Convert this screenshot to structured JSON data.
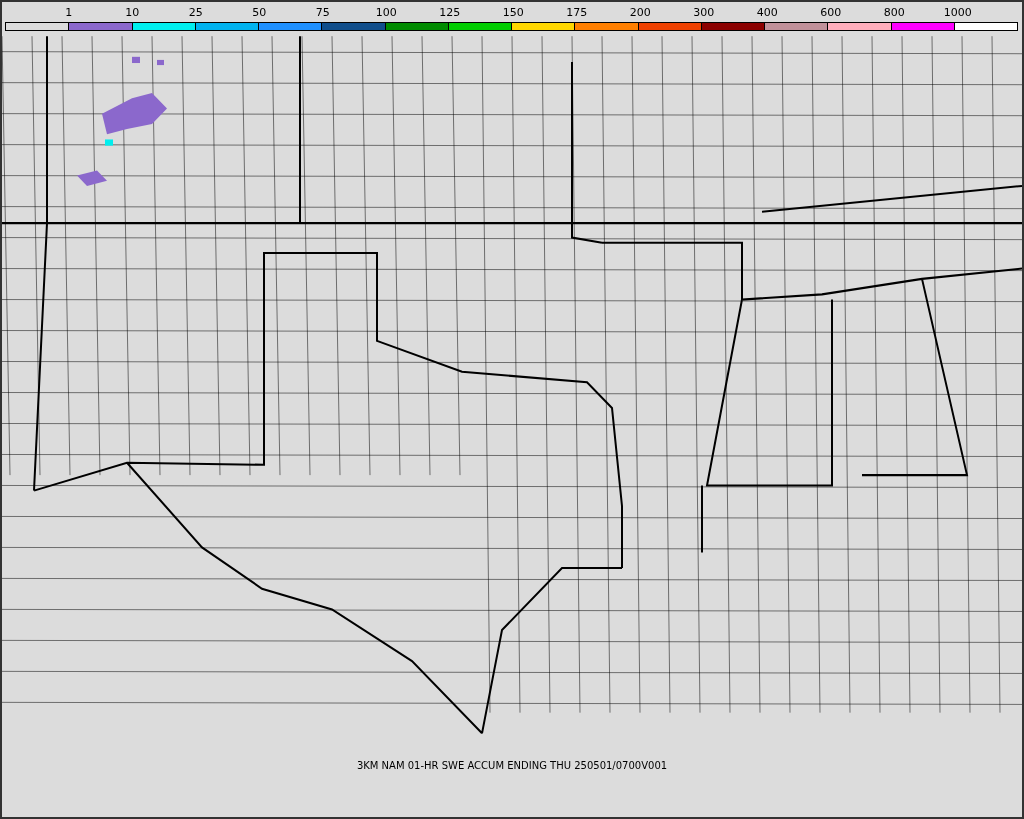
{
  "legend": {
    "labels": [
      "1",
      "10",
      "25",
      "50",
      "75",
      "100",
      "125",
      "150",
      "175",
      "200",
      "300",
      "400",
      "600",
      "800",
      "1000"
    ],
    "swatches": [
      {
        "color": "#dcdcdc"
      },
      {
        "color": "#8b68cc"
      },
      {
        "color": "#00eeee"
      },
      {
        "color": "#00b2ee"
      },
      {
        "color": "#1e90ff"
      },
      {
        "color": "#104e8b"
      },
      {
        "color": "#008b00"
      },
      {
        "color": "#00cd00"
      },
      {
        "color": "#ffd700"
      },
      {
        "color": "#ff7f00"
      },
      {
        "color": "#ee4000"
      },
      {
        "color": "#8b0000"
      },
      {
        "color": "#c1919a"
      },
      {
        "color": "#ffaebc"
      },
      {
        "color": "#ff00ff"
      },
      {
        "color": "#ffffff"
      }
    ]
  },
  "caption": "3KM NAM 01-HR SWE ACCUM ENDING THU 250501/0700V001"
}
